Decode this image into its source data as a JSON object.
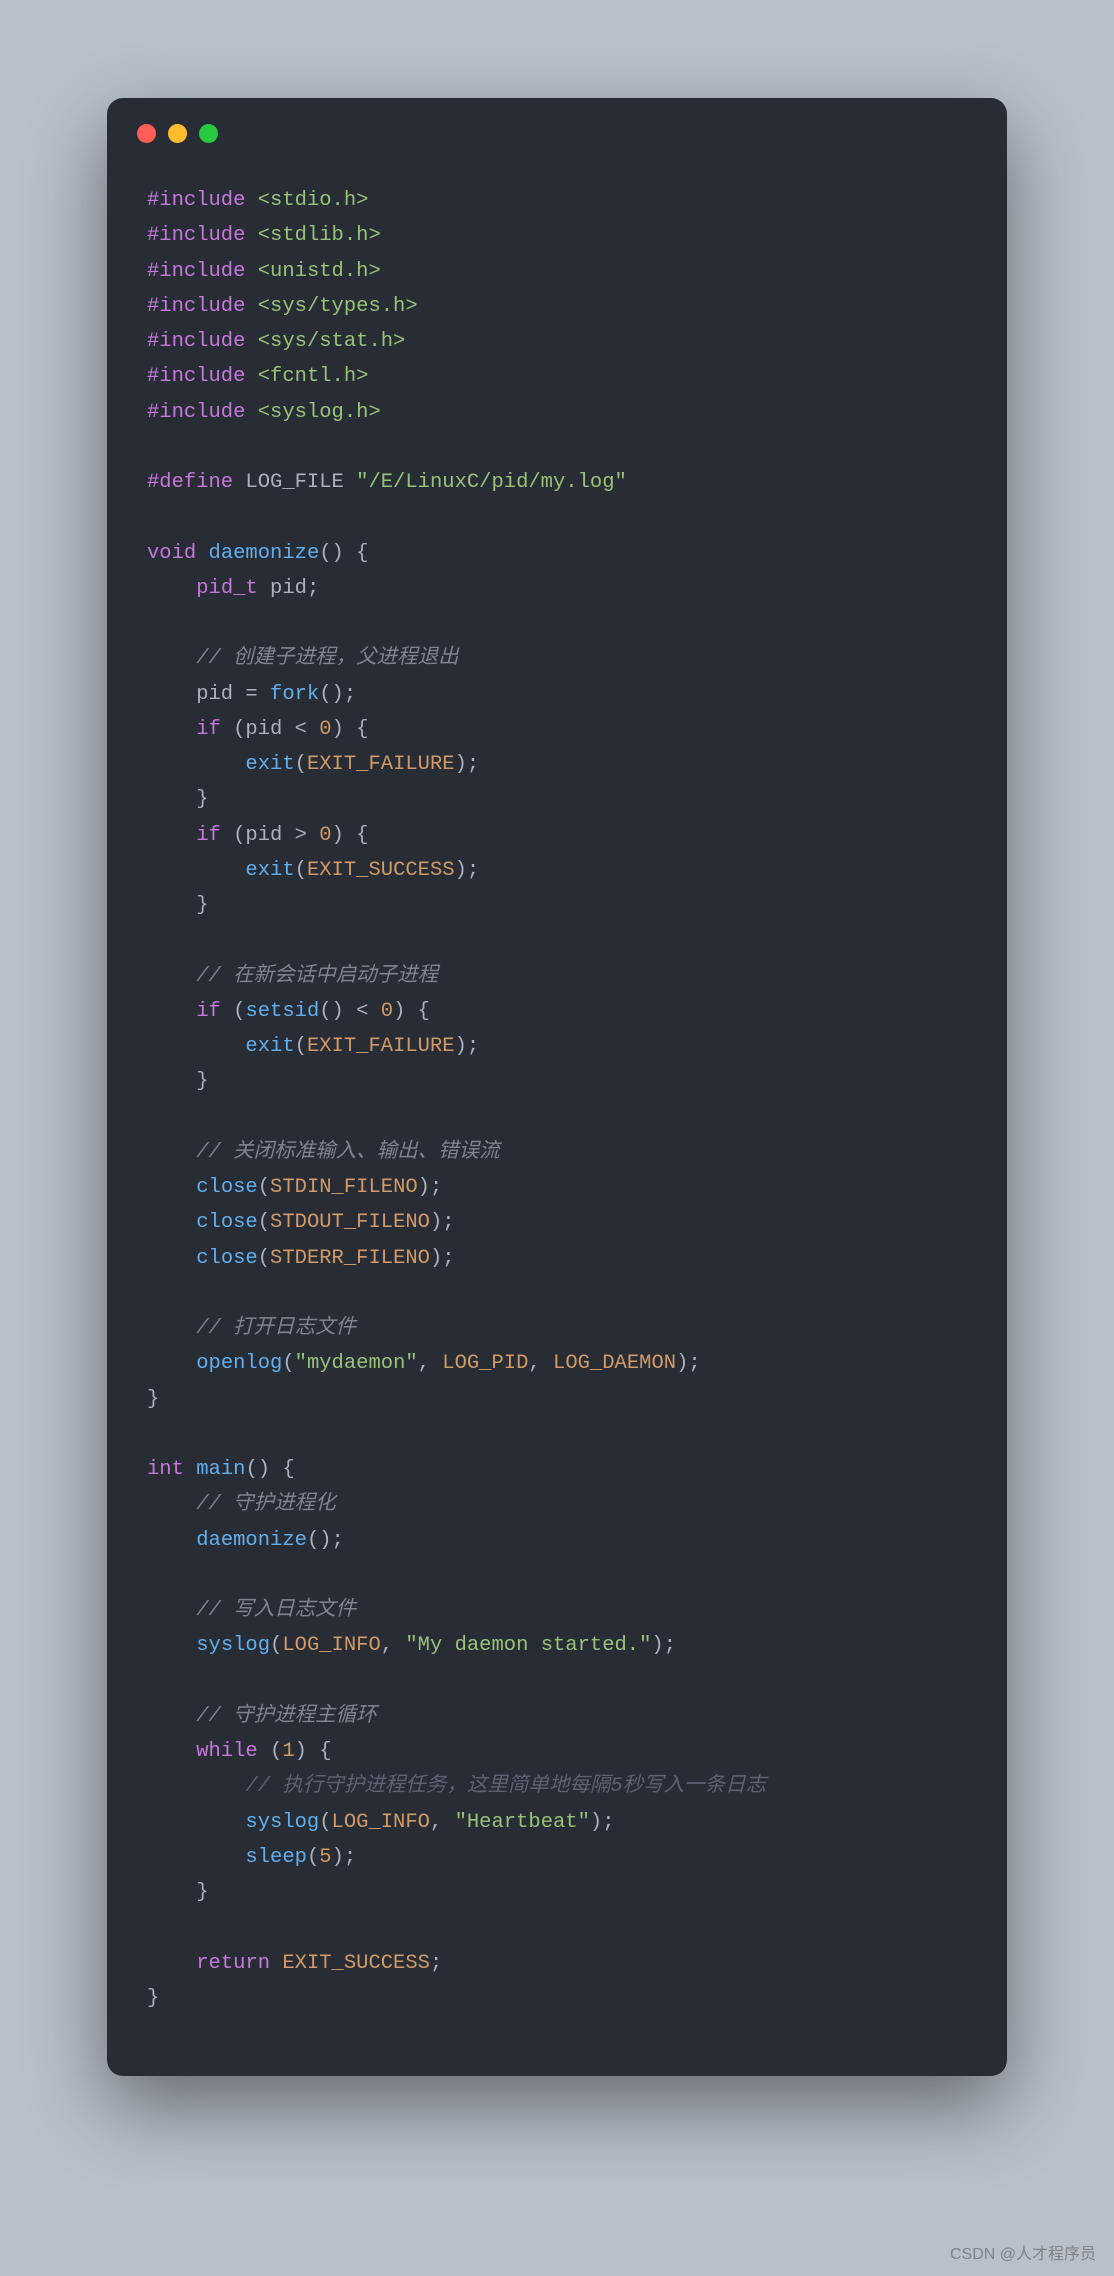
{
  "window": {
    "buttons": [
      "close",
      "minimize",
      "maximize"
    ]
  },
  "watermark": "CSDN @人才程序员",
  "code": {
    "lines": [
      [
        {
          "t": "#include",
          "c": "pp"
        },
        {
          "t": " ",
          "c": "p"
        },
        {
          "t": "<stdio.h>",
          "c": "hdr"
        }
      ],
      [
        {
          "t": "#include",
          "c": "pp"
        },
        {
          "t": " ",
          "c": "p"
        },
        {
          "t": "<stdlib.h>",
          "c": "hdr"
        }
      ],
      [
        {
          "t": "#include",
          "c": "pp"
        },
        {
          "t": " ",
          "c": "p"
        },
        {
          "t": "<unistd.h>",
          "c": "hdr"
        }
      ],
      [
        {
          "t": "#include",
          "c": "pp"
        },
        {
          "t": " ",
          "c": "p"
        },
        {
          "t": "<sys/types.h>",
          "c": "hdr"
        }
      ],
      [
        {
          "t": "#include",
          "c": "pp"
        },
        {
          "t": " ",
          "c": "p"
        },
        {
          "t": "<sys/stat.h>",
          "c": "hdr"
        }
      ],
      [
        {
          "t": "#include",
          "c": "pp"
        },
        {
          "t": " ",
          "c": "p"
        },
        {
          "t": "<fcntl.h>",
          "c": "hdr"
        }
      ],
      [
        {
          "t": "#include",
          "c": "pp"
        },
        {
          "t": " ",
          "c": "p"
        },
        {
          "t": "<syslog.h>",
          "c": "hdr"
        }
      ],
      [],
      [
        {
          "t": "#define",
          "c": "pp"
        },
        {
          "t": " LOG_FILE ",
          "c": "p"
        },
        {
          "t": "\"/E/LinuxC/pid/my.log\"",
          "c": "str"
        }
      ],
      [],
      [
        {
          "t": "void",
          "c": "type"
        },
        {
          "t": " ",
          "c": "p"
        },
        {
          "t": "daemonize",
          "c": "fn"
        },
        {
          "t": "() {",
          "c": "p"
        }
      ],
      [
        {
          "t": "    ",
          "c": "p"
        },
        {
          "t": "pid_t",
          "c": "type"
        },
        {
          "t": " pid;",
          "c": "p"
        }
      ],
      [],
      [
        {
          "t": "    ",
          "c": "p"
        },
        {
          "t": "// 创建子进程，父进程退出",
          "c": "cm"
        }
      ],
      [
        {
          "t": "    pid = ",
          "c": "p"
        },
        {
          "t": "fork",
          "c": "fn"
        },
        {
          "t": "();",
          "c": "p"
        }
      ],
      [
        {
          "t": "    ",
          "c": "p"
        },
        {
          "t": "if",
          "c": "kw"
        },
        {
          "t": " (pid < ",
          "c": "p"
        },
        {
          "t": "0",
          "c": "num"
        },
        {
          "t": ") {",
          "c": "p"
        }
      ],
      [
        {
          "t": "        ",
          "c": "p"
        },
        {
          "t": "exit",
          "c": "fn"
        },
        {
          "t": "(",
          "c": "p"
        },
        {
          "t": "EXIT_FAILURE",
          "c": "const"
        },
        {
          "t": ");",
          "c": "p"
        }
      ],
      [
        {
          "t": "    }",
          "c": "p"
        }
      ],
      [
        {
          "t": "    ",
          "c": "p"
        },
        {
          "t": "if",
          "c": "kw"
        },
        {
          "t": " (pid > ",
          "c": "p"
        },
        {
          "t": "0",
          "c": "num"
        },
        {
          "t": ") {",
          "c": "p"
        }
      ],
      [
        {
          "t": "        ",
          "c": "p"
        },
        {
          "t": "exit",
          "c": "fn"
        },
        {
          "t": "(",
          "c": "p"
        },
        {
          "t": "EXIT_SUCCESS",
          "c": "const"
        },
        {
          "t": ");",
          "c": "p"
        }
      ],
      [
        {
          "t": "    }",
          "c": "p"
        }
      ],
      [],
      [
        {
          "t": "    ",
          "c": "p"
        },
        {
          "t": "// 在新会话中启动子进程",
          "c": "cm"
        }
      ],
      [
        {
          "t": "    ",
          "c": "p"
        },
        {
          "t": "if",
          "c": "kw"
        },
        {
          "t": " (",
          "c": "p"
        },
        {
          "t": "setsid",
          "c": "fn"
        },
        {
          "t": "() < ",
          "c": "p"
        },
        {
          "t": "0",
          "c": "num"
        },
        {
          "t": ") {",
          "c": "p"
        }
      ],
      [
        {
          "t": "        ",
          "c": "p"
        },
        {
          "t": "exit",
          "c": "fn"
        },
        {
          "t": "(",
          "c": "p"
        },
        {
          "t": "EXIT_FAILURE",
          "c": "const"
        },
        {
          "t": ");",
          "c": "p"
        }
      ],
      [
        {
          "t": "    }",
          "c": "p"
        }
      ],
      [],
      [
        {
          "t": "    ",
          "c": "p"
        },
        {
          "t": "// 关闭标准输入、输出、错误流",
          "c": "cm"
        }
      ],
      [
        {
          "t": "    ",
          "c": "p"
        },
        {
          "t": "close",
          "c": "fn"
        },
        {
          "t": "(",
          "c": "p"
        },
        {
          "t": "STDIN_FILENO",
          "c": "const"
        },
        {
          "t": ");",
          "c": "p"
        }
      ],
      [
        {
          "t": "    ",
          "c": "p"
        },
        {
          "t": "close",
          "c": "fn"
        },
        {
          "t": "(",
          "c": "p"
        },
        {
          "t": "STDOUT_FILENO",
          "c": "const"
        },
        {
          "t": ");",
          "c": "p"
        }
      ],
      [
        {
          "t": "    ",
          "c": "p"
        },
        {
          "t": "close",
          "c": "fn"
        },
        {
          "t": "(",
          "c": "p"
        },
        {
          "t": "STDERR_FILENO",
          "c": "const"
        },
        {
          "t": ");",
          "c": "p"
        }
      ],
      [],
      [
        {
          "t": "    ",
          "c": "p"
        },
        {
          "t": "// 打开日志文件",
          "c": "cm"
        }
      ],
      [
        {
          "t": "    ",
          "c": "p"
        },
        {
          "t": "openlog",
          "c": "fn"
        },
        {
          "t": "(",
          "c": "p"
        },
        {
          "t": "\"mydaemon\"",
          "c": "str"
        },
        {
          "t": ", ",
          "c": "p"
        },
        {
          "t": "LOG_PID",
          "c": "const"
        },
        {
          "t": ", ",
          "c": "p"
        },
        {
          "t": "LOG_DAEMON",
          "c": "const"
        },
        {
          "t": ");",
          "c": "p"
        }
      ],
      [
        {
          "t": "}",
          "c": "p"
        }
      ],
      [],
      [
        {
          "t": "int",
          "c": "type"
        },
        {
          "t": " ",
          "c": "p"
        },
        {
          "t": "main",
          "c": "fn"
        },
        {
          "t": "() {",
          "c": "p"
        }
      ],
      [
        {
          "t": "    ",
          "c": "p"
        },
        {
          "t": "// 守护进程化",
          "c": "cm"
        }
      ],
      [
        {
          "t": "    ",
          "c": "p"
        },
        {
          "t": "daemonize",
          "c": "fn"
        },
        {
          "t": "();",
          "c": "p"
        }
      ],
      [],
      [
        {
          "t": "    ",
          "c": "p"
        },
        {
          "t": "// 写入日志文件",
          "c": "cm"
        }
      ],
      [
        {
          "t": "    ",
          "c": "p"
        },
        {
          "t": "syslog",
          "c": "fn"
        },
        {
          "t": "(",
          "c": "p"
        },
        {
          "t": "LOG_INFO",
          "c": "const"
        },
        {
          "t": ", ",
          "c": "p"
        },
        {
          "t": "\"My daemon started.\"",
          "c": "str"
        },
        {
          "t": ");",
          "c": "p"
        }
      ],
      [],
      [
        {
          "t": "    ",
          "c": "p"
        },
        {
          "t": "// 守护进程主循环",
          "c": "cm"
        }
      ],
      [
        {
          "t": "    ",
          "c": "p"
        },
        {
          "t": "while",
          "c": "kw"
        },
        {
          "t": " (",
          "c": "p"
        },
        {
          "t": "1",
          "c": "num"
        },
        {
          "t": ") {",
          "c": "p"
        }
      ],
      [
        {
          "t": "        ",
          "c": "p"
        },
        {
          "t": "// 执行守护进程任务，这里简单地每隔5秒写入一条日志",
          "c": "cm2"
        }
      ],
      [
        {
          "t": "        ",
          "c": "p"
        },
        {
          "t": "syslog",
          "c": "fn"
        },
        {
          "t": "(",
          "c": "p"
        },
        {
          "t": "LOG_INFO",
          "c": "const"
        },
        {
          "t": ", ",
          "c": "p"
        },
        {
          "t": "\"Heartbeat\"",
          "c": "str"
        },
        {
          "t": ");",
          "c": "p"
        }
      ],
      [
        {
          "t": "        ",
          "c": "p"
        },
        {
          "t": "sleep",
          "c": "fn"
        },
        {
          "t": "(",
          "c": "p"
        },
        {
          "t": "5",
          "c": "num"
        },
        {
          "t": ");",
          "c": "p"
        }
      ],
      [
        {
          "t": "    }",
          "c": "p"
        }
      ],
      [],
      [
        {
          "t": "    ",
          "c": "p"
        },
        {
          "t": "return",
          "c": "kw"
        },
        {
          "t": " ",
          "c": "p"
        },
        {
          "t": "EXIT_SUCCESS",
          "c": "const"
        },
        {
          "t": ";",
          "c": "p"
        }
      ],
      [
        {
          "t": "}",
          "c": "p"
        }
      ]
    ]
  }
}
